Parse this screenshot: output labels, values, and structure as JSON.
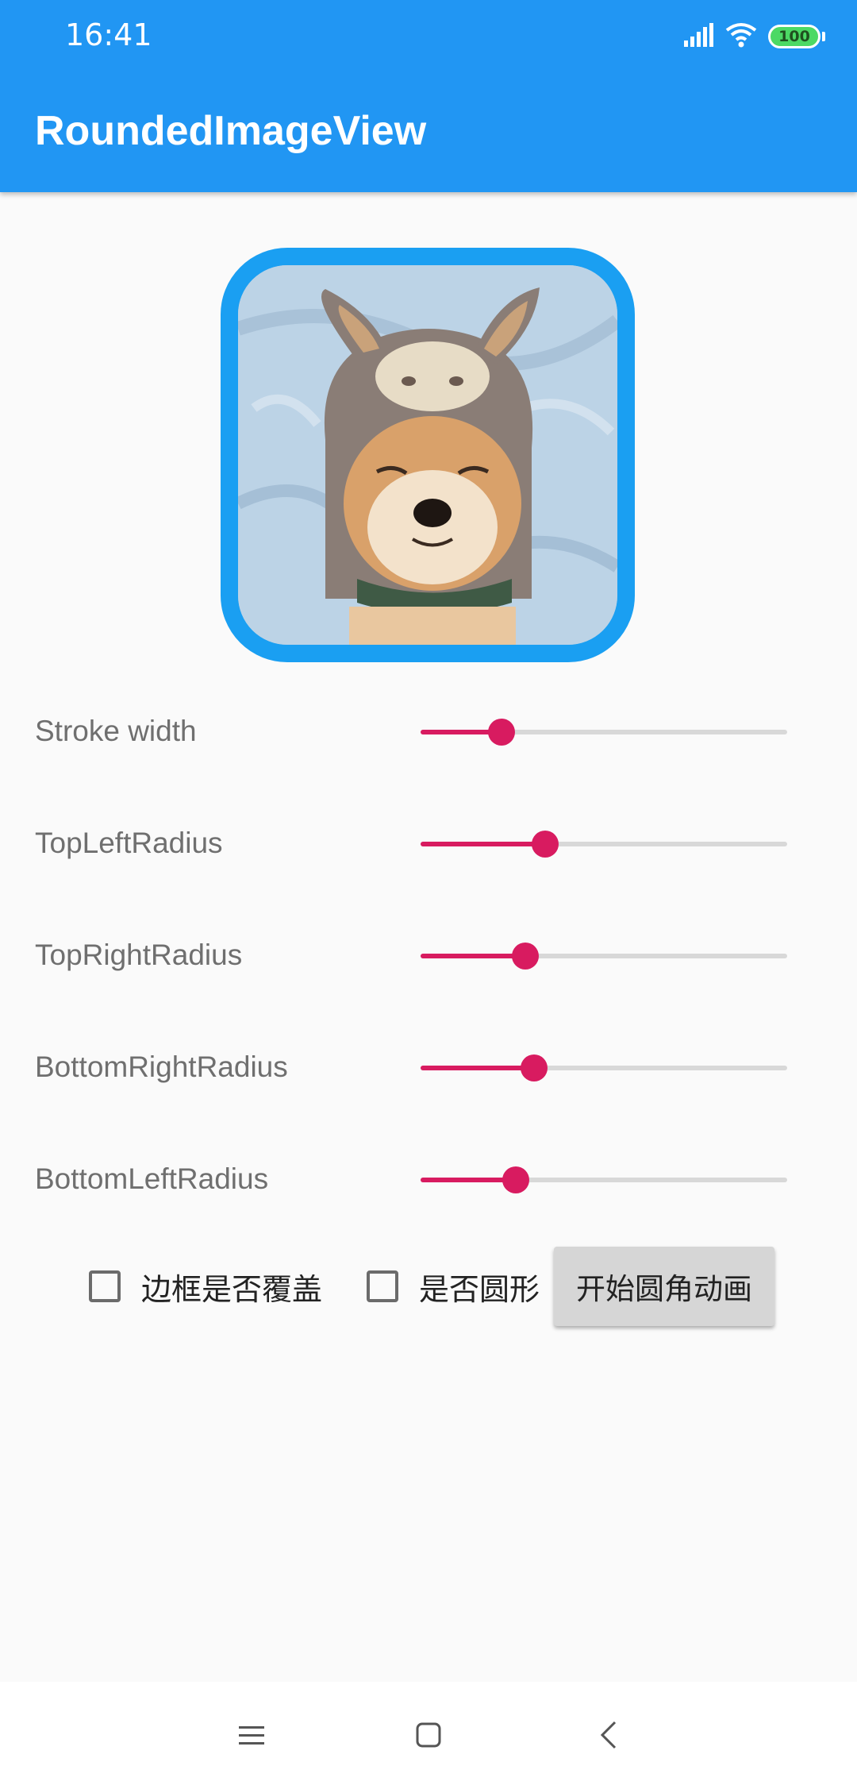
{
  "status_bar": {
    "time": "16:41",
    "battery": "100",
    "icons": [
      "signal-icon",
      "wifi-icon",
      "battery-icon"
    ]
  },
  "toolbar": {
    "title": "RoundedImageView"
  },
  "image": {
    "description_icon": "dog-photo",
    "border_color": "#1a9ff2"
  },
  "sliders": [
    {
      "label": "Stroke width",
      "value": 0.22
    },
    {
      "label": "TopLeftRadius",
      "value": 0.34
    },
    {
      "label": "TopRightRadius",
      "value": 0.285
    },
    {
      "label": "BottomRightRadius",
      "value": 0.31
    },
    {
      "label": "BottomLeftRadius",
      "value": 0.26
    }
  ],
  "controls": {
    "border_overlay_label": "边框是否覆盖",
    "circle_label": "是否圆形",
    "animate_button": "开始圆角动画"
  },
  "nav": {
    "menu": "menu-icon",
    "home": "home-icon",
    "back": "back-icon"
  },
  "colors": {
    "primary": "#2196f3",
    "accent": "#d81b60",
    "frame": "#1a9ff2"
  }
}
